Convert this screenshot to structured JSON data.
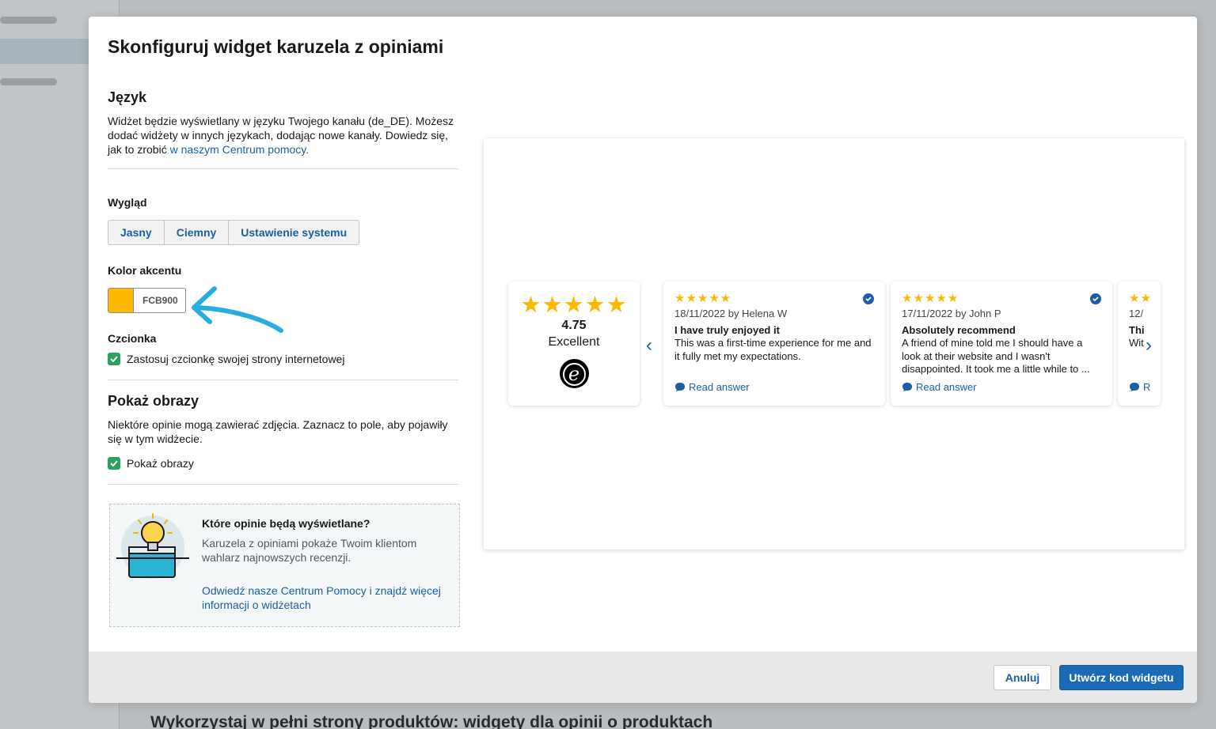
{
  "background": {
    "page_heading": "Wykorzystaj w pełni strony produktów: widgety dla opinii o produktach"
  },
  "modal": {
    "title": "Skonfiguruj widget karuzela z opiniami",
    "language": {
      "heading": "Język",
      "text": "Widżet będzie wyświetlany w języku Twojego kanału (de_DE). Możesz dodać widżety w innych językach, dodając nowe kanały. Dowiedz się, jak to zrobić ",
      "link": "w naszym Centrum pomocy."
    },
    "appearance": {
      "label": "Wygląd",
      "options": [
        "Jasny",
        "Ciemny",
        "Ustawienie systemu"
      ]
    },
    "accent": {
      "label": "Kolor akcentu",
      "value": "FCB900",
      "color": "#FCB900"
    },
    "font": {
      "label": "Czcionka",
      "checkbox_label": "Zastosuj czcionkę swojej strony internetowej",
      "checked": true
    },
    "images": {
      "heading": "Pokaż obrazy",
      "text": "Niektóre opinie mogą zawierać zdjęcia. Zaznacz to pole, aby pojawiły się w tym widżecie.",
      "checkbox_label": "Pokaż obrazy",
      "checked": true
    },
    "info": {
      "title": "Które opinie będą wyświetlane?",
      "text": "Karuzela z opiniami pokaże Twoim klientom wahlarz najnowszych recenzji.",
      "link": "Odwiedź nasze Centrum Pomocy i znajdź więcej informacji o widżetach"
    },
    "preview": {
      "summary": {
        "stars": "★★★★★",
        "score": "4.75",
        "rating": "Excellent",
        "logo_letter": "e"
      },
      "reviews": [
        {
          "stars": "★★★★★",
          "meta": "18/11/2022 by Helena W",
          "title": "I have truly enjoyed it",
          "body": "This was a first-time experience for me and it fully met my expectations.",
          "answer": "Read answer"
        },
        {
          "stars": "★★★★★",
          "meta": "17/11/2022 by John P",
          "title": "Absolutely recommend",
          "body": "A friend of mine told me I should have a look at their website and I wasn't disappointed. It took me a little while to ...",
          "answer": "Read answer"
        },
        {
          "stars": "★★",
          "meta": "12/",
          "title": "Thi",
          "body": "Wit",
          "answer": "R"
        }
      ],
      "prev_icon": "‹",
      "next_icon": "›"
    },
    "footer": {
      "cancel": "Anuluj",
      "create": "Utwórz kod widgetu"
    }
  }
}
